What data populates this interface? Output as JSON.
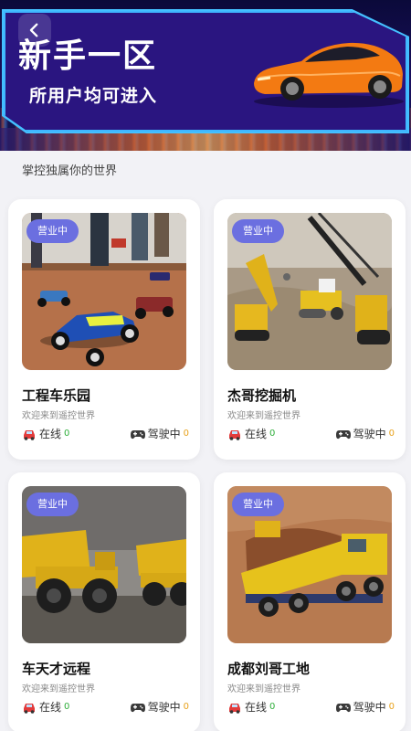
{
  "header": {
    "title": "新手一区",
    "subtitle": "所用户均可进入",
    "caption": "掌控独属你的世界"
  },
  "colors": {
    "banner_bg": "#1a0f5e",
    "panel": "#2a1580",
    "badge": "#6b6fe0",
    "online": "#2fae3b",
    "driving": "#e8a21c"
  },
  "cards": [
    {
      "badge": "营业中",
      "name": "工程车乐园",
      "desc": "欢迎来到遥控世界",
      "online_label": "在线",
      "online_count": "0",
      "driving_label": "驾驶中",
      "driving_count": "0"
    },
    {
      "badge": "营业中",
      "name": "杰哥挖掘机",
      "desc": "欢迎来到遥控世界",
      "online_label": "在线",
      "online_count": "0",
      "driving_label": "驾驶中",
      "driving_count": "0"
    },
    {
      "badge": "营业中",
      "name": "车天才远程",
      "desc": "欢迎来到遥控世界",
      "online_label": "在线",
      "online_count": "0",
      "driving_label": "驾驶中",
      "driving_count": "0"
    },
    {
      "badge": "营业中",
      "name": "成都刘哥工地",
      "desc": "欢迎来到遥控世界",
      "online_label": "在线",
      "online_count": "0",
      "driving_label": "驾驶中",
      "driving_count": "0"
    }
  ],
  "icons": {
    "back": "chevron-left-icon",
    "online": "car-icon",
    "driving": "gamepad-icon"
  }
}
